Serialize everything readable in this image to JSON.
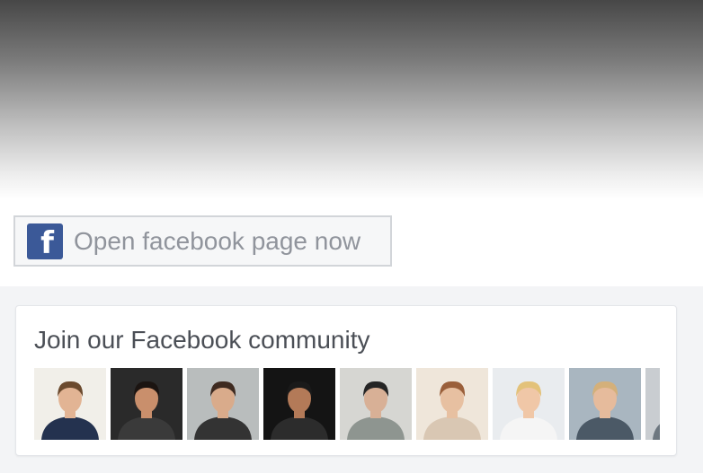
{
  "fb_button": {
    "label": "Open facebook page now",
    "icon": "facebook-f-icon",
    "brand_color": "#3b5998"
  },
  "community": {
    "title": "Join our Facebook community",
    "members": [
      {
        "name": "member-1",
        "background": "#f1efe9",
        "skin": "#e2b494",
        "hair": "#6b4a2e",
        "shirt": "#24324f"
      },
      {
        "name": "member-2",
        "background": "#2a2a2a",
        "skin": "#c98f6c",
        "hair": "#1b1411",
        "shirt": "#3a3a3a"
      },
      {
        "name": "member-3",
        "background": "#b9bdbd",
        "skin": "#d9ab8b",
        "hair": "#3e2a20",
        "shirt": "#333333"
      },
      {
        "name": "member-4",
        "background": "#141414",
        "skin": "#b37a58",
        "hair": "#1a1a1a",
        "shirt": "#2c2c2c"
      },
      {
        "name": "member-5",
        "background": "#d6d6d2",
        "skin": "#d8b096",
        "hair": "#252525",
        "shirt": "#8e9590"
      },
      {
        "name": "member-6",
        "background": "#efe6da",
        "skin": "#e7c0a1",
        "hair": "#9a5f3a",
        "shirt": "#d9c7b3"
      },
      {
        "name": "member-7",
        "background": "#e9ecef",
        "skin": "#f0c7a7",
        "hair": "#e3c27a",
        "shirt": "#f5f5f5"
      },
      {
        "name": "member-8",
        "background": "#a9b6c0",
        "skin": "#e6bb9c",
        "hair": "#d4b07a",
        "shirt": "#4b5966"
      },
      {
        "name": "member-9",
        "background": "#c9cdd1",
        "skin": "#e0b496",
        "hair": "#4a3424",
        "shirt": "#6d7780"
      }
    ]
  }
}
